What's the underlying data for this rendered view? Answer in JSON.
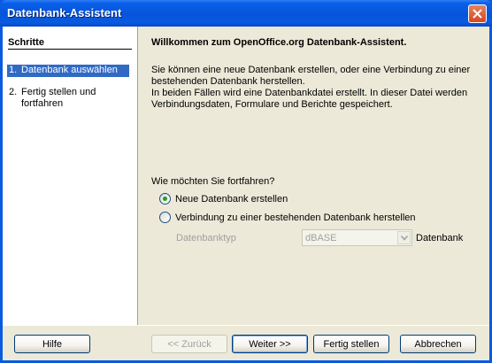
{
  "window": {
    "title": "Datenbank-Assistent"
  },
  "steps": {
    "heading": "Schritte",
    "items": [
      {
        "num": "1.",
        "label": "Datenbank auswählen"
      },
      {
        "num": "2.",
        "label": "Fertig stellen und fortfahren"
      }
    ]
  },
  "content": {
    "welcome": "Willkommen zum OpenOffice.org Datenbank-Assistent.",
    "intro_line1": "Sie können eine neue Datenbank erstellen, oder eine Verbindung zu einer bestehenden  Datenbank herstellen.",
    "intro_line2": "In beiden Fällen wird eine Datenbankdatei erstellt. In dieser Datei werden Verbindungsdaten, Formulare und Berichte gespeichert.",
    "question": "Wie möchten Sie fortfahren?",
    "option_new": "Neue Datenbank erstellen",
    "option_connect": "Verbindung zu einer bestehenden Datenbank herstellen",
    "dbtype_label": "Datenbanktyp",
    "dbtype_value": "dBASE",
    "dbtype_suffix": "Datenbank"
  },
  "buttons": {
    "help": "Hilfe",
    "back": "<< Zurück",
    "next": "Weiter >>",
    "finish": "Fertig stellen",
    "cancel": "Abbrechen"
  },
  "colors": {
    "titlebar": "#0a5ae0",
    "selection": "#316ac5",
    "dialog_bg": "#ece9d8"
  }
}
